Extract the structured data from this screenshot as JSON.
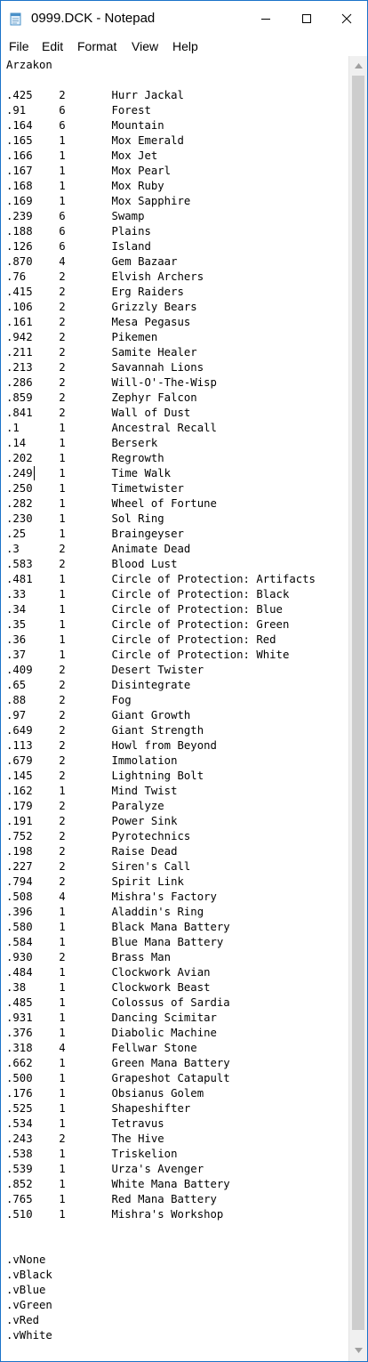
{
  "window": {
    "title": "0999.DCK - Notepad",
    "icon": "notepad-icon",
    "accent_color": "#1a73c9"
  },
  "menu": [
    "File",
    "Edit",
    "Format",
    "View",
    "Help"
  ],
  "editor": {
    "lines": [
      "Arzakon",
      "",
      ".425    2       Hurr Jackal",
      ".91     6       Forest",
      ".164    6       Mountain",
      ".165    1       Mox Emerald",
      ".166    1       Mox Jet",
      ".167    1       Mox Pearl",
      ".168    1       Mox Ruby",
      ".169    1       Mox Sapphire",
      ".239    6       Swamp",
      ".188    6       Plains",
      ".126    6       Island",
      ".870    4       Gem Bazaar",
      ".76     2       Elvish Archers",
      ".415    2       Erg Raiders",
      ".106    2       Grizzly Bears",
      ".161    2       Mesa Pegasus",
      ".942    2       Pikemen",
      ".211    2       Samite Healer",
      ".213    2       Savannah Lions",
      ".286    2       Will-O'-The-Wisp",
      ".859    2       Zephyr Falcon",
      ".841    2       Wall of Dust",
      ".1      1       Ancestral Recall",
      ".14     1       Berserk",
      ".202    1       Regrowth",
      ".249    1       Time Walk",
      ".250    1       Timetwister",
      ".282    1       Wheel of Fortune",
      ".230    1       Sol Ring",
      ".25     1       Braingeyser",
      ".3      2       Animate Dead",
      ".583    2       Blood Lust",
      ".481    1       Circle of Protection: Artifacts",
      ".33     1       Circle of Protection: Black",
      ".34     1       Circle of Protection: Blue",
      ".35     1       Circle of Protection: Green",
      ".36     1       Circle of Protection: Red",
      ".37     1       Circle of Protection: White",
      ".409    2       Desert Twister",
      ".65     2       Disintegrate",
      ".88     2       Fog",
      ".97     2       Giant Growth",
      ".649    2       Giant Strength",
      ".113    2       Howl from Beyond",
      ".679    2       Immolation",
      ".145    2       Lightning Bolt",
      ".162    1       Mind Twist",
      ".179    2       Paralyze",
      ".191    2       Power Sink",
      ".752    2       Pyrotechnics",
      ".198    2       Raise Dead",
      ".227    2       Siren's Call",
      ".794    2       Spirit Link",
      ".508    4       Mishra's Factory",
      ".396    1       Aladdin's Ring",
      ".580    1       Black Mana Battery",
      ".584    1       Blue Mana Battery",
      ".930    2       Brass Man",
      ".484    1       Clockwork Avian",
      ".38     1       Clockwork Beast",
      ".485    1       Colossus of Sardia",
      ".931    1       Dancing Scimitar",
      ".376    1       Diabolic Machine",
      ".318    4       Fellwar Stone",
      ".662    1       Green Mana Battery",
      ".500    1       Grapeshot Catapult",
      ".176    1       Obsianus Golem",
      ".525    1       Shapeshifter",
      ".534    1       Tetravus",
      ".243    2       The Hive",
      ".538    1       Triskelion",
      ".539    1       Urza's Avenger",
      ".852    1       White Mana Battery",
      ".765    1       Red Mana Battery",
      ".510    1       Mishra's Workshop",
      "",
      "",
      ".vNone",
      ".vBlack",
      ".vBlue",
      ".vGreen",
      ".vRed",
      ".vWhite"
    ]
  }
}
